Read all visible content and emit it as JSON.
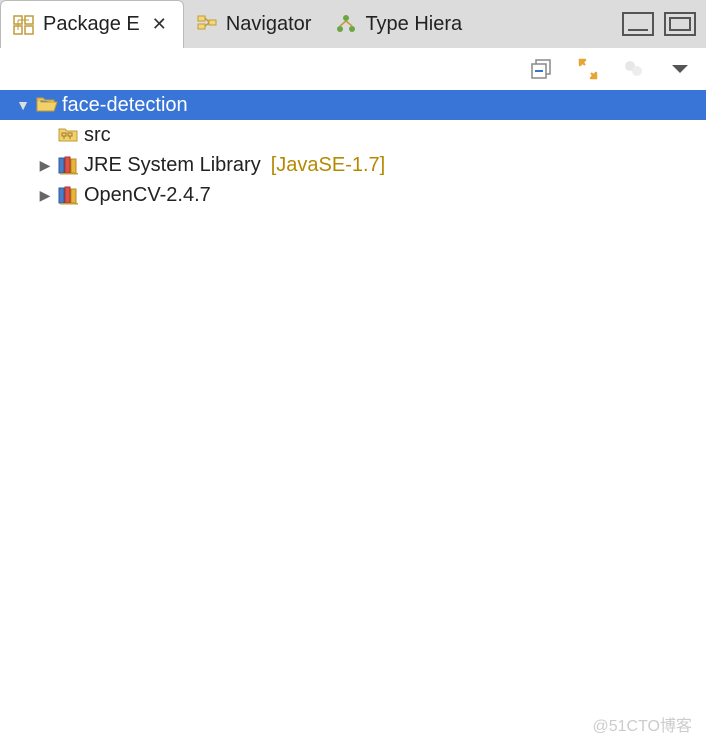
{
  "tabs": [
    {
      "label": "Package E",
      "active": true
    },
    {
      "label": "Navigator",
      "active": false
    },
    {
      "label": "Type Hiera",
      "active": false
    }
  ],
  "tree": {
    "root": {
      "label": "face-detection",
      "children": [
        {
          "label": "src",
          "type": "folder"
        },
        {
          "label": "JRE System Library",
          "decoration": "[JavaSE-1.7]",
          "type": "library",
          "expandable": true
        },
        {
          "label": "OpenCV-2.4.7",
          "type": "library",
          "expandable": true
        }
      ]
    }
  },
  "watermark": "@51CTO博客"
}
